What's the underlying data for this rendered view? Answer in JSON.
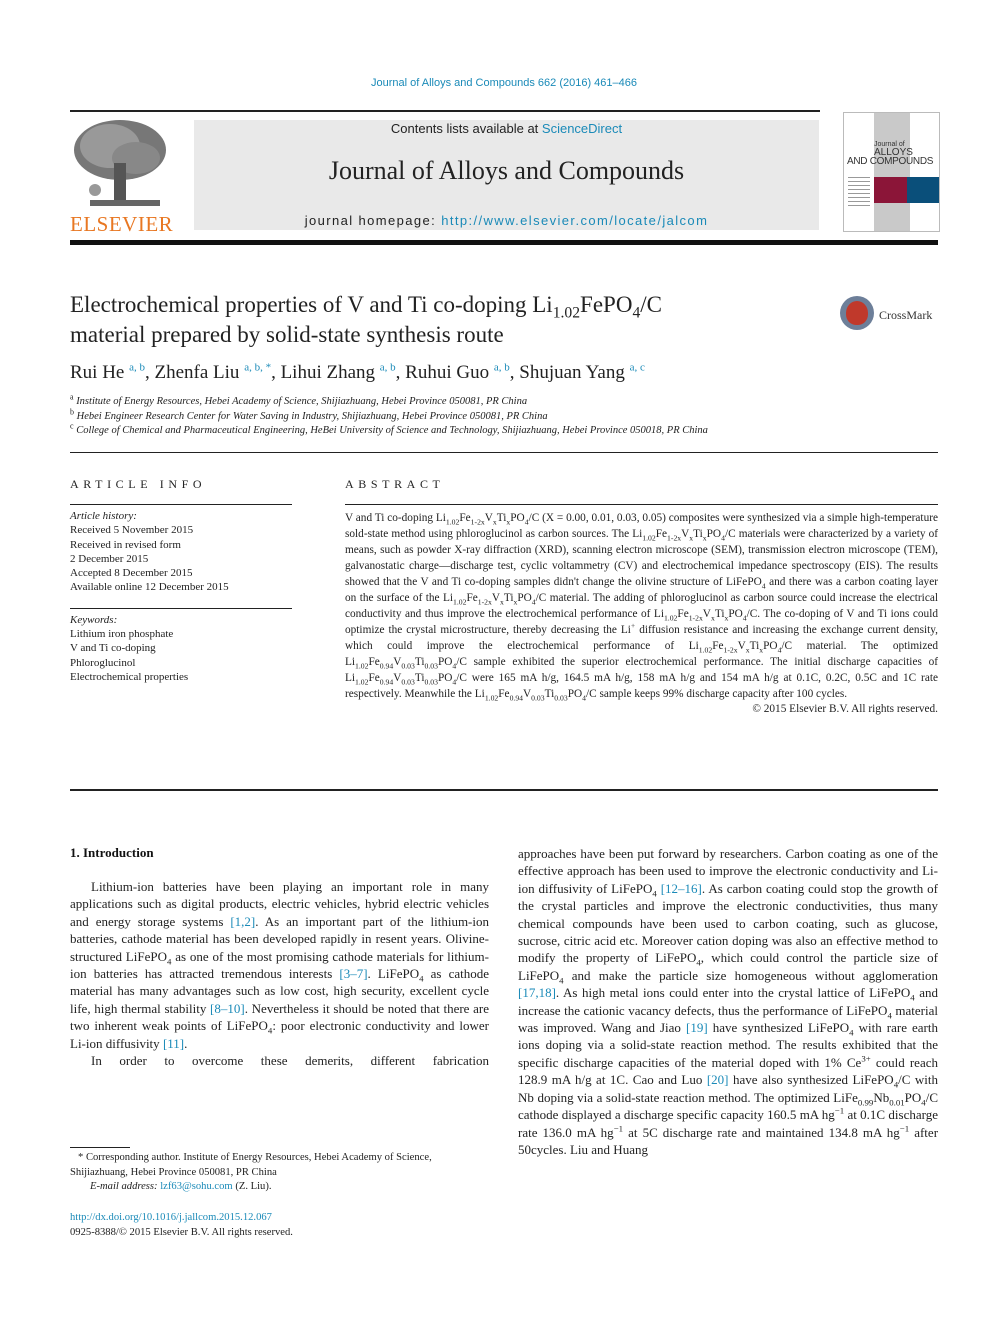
{
  "header": {
    "citation": "Journal of Alloys and Compounds 662 (2016) 461–466",
    "publisher_logo_text": "ELSEVIER",
    "contents_prefix": "Contents lists available at ",
    "contents_link": "ScienceDirect",
    "journal_title": "Journal of Alloys and Compounds",
    "homepage_prefix": "journal homepage: ",
    "homepage_link": "http://www.elsevier.com/locate/jalcom",
    "cover": {
      "line1": "Journal of",
      "line2": "ALLOYS",
      "line3": "AND COMPOUNDS",
      "colors": {
        "red": "#8b1538",
        "blue": "#0a4f7a"
      }
    }
  },
  "article": {
    "title_part1": "Electrochemical properties of V and Ti co-doping Li",
    "title_sub1": "1.02",
    "title_part2": "FePO",
    "title_sub2": "4",
    "title_part3": "/C",
    "title_line2": "material prepared by solid-state synthesis route",
    "crossmark_label": "CrossMark",
    "authors": [
      {
        "name": "Rui He",
        "affil": "a, b"
      },
      {
        "name": "Zhenfa Liu",
        "affil": "a, b, *"
      },
      {
        "name": "Lihui Zhang",
        "affil": "a, b"
      },
      {
        "name": "Ruhui Guo",
        "affil": "a, b"
      },
      {
        "name": "Shujuan Yang",
        "affil": "a, c"
      }
    ],
    "affiliations": [
      {
        "key": "a",
        "text": "Institute of Energy Resources, Hebei Academy of Science, Shijiazhuang, Hebei Province 050081, PR China"
      },
      {
        "key": "b",
        "text": "Hebei Engineer Research Center for Water Saving in Industry, Shijiazhuang, Hebei Province 050081, PR China"
      },
      {
        "key": "c",
        "text": "College of Chemical and Pharmaceutical Engineering, HeBei University of Science and Technology, Shijiazhuang, Hebei Province 050018, PR China"
      }
    ]
  },
  "article_info": {
    "heading": "ARTICLE INFO",
    "history_label": "Article history:",
    "history": [
      "Received 5 November 2015",
      "Received in revised form",
      "2 December 2015",
      "Accepted 8 December 2015",
      "Available online 12 December 2015"
    ],
    "keywords_label": "Keywords:",
    "keywords": [
      "Lithium iron phosphate",
      "V and Ti co-doping",
      "Phloroglucinol",
      "Electrochemical properties"
    ]
  },
  "abstract": {
    "heading": "ABSTRACT",
    "s1": "V and Ti co-doping ",
    "s2": " (X = 0.00, 0.01, 0.03, 0.05) composites were synthesized via a simple high-temperature sold-state method using phloroglucinol as carbon sources. The ",
    "s3": " materials were characterized by a variety of means, such as powder X-ray diffraction (XRD), scanning electron microscope (SEM), transmission electron microscope (TEM), galvanostatic charge—discharge test, cyclic voltammetry (CV) and electrochemical impedance spectroscopy (EIS). The results showed that the V and Ti co-doping samples didn't change the olivine structure of LiFePO",
    "s4": " and there was a carbon coating layer on the surface of the ",
    "s5": " material. The adding of phloroglucinol as carbon source could increase the electrical conductivity and thus improve the electrochemical performance of ",
    "s6": ". The co-doping of V and Ti ions could optimize the crystal microstructure, thereby decreasing the Li",
    "s7": " diffusion resistance and increasing the exchange current density, which could improve the electrochemical performance of ",
    "s8": " material. The optimized ",
    "s9": " sample exhibited the superior electrochemical performance. The initial discharge capacities of ",
    "s10": " were 165 mA h/g, 164.5 mA h/g, 158 mA h/g and 154 mA h/g at 0.1C, 0.2C, 0.5C and 1C rate respectively. Meanwhile the ",
    "s11": " sample keeps 99% discharge capacity after 100 cycles.",
    "copyright": "© 2015 Elsevier B.V. All rights reserved."
  },
  "introduction": {
    "heading": "1.  Introduction",
    "p1a": "Lithium-ion batteries have been playing an important role in many applications such as digital products, electric vehicles, hybrid electric vehicles and energy storage systems ",
    "ref1": "[1,2]",
    "p1b": ". As an important part of the lithium-ion batteries, cathode material has been developed rapidly in resent years. Olivine-structured LiFePO",
    "p1c": " as one of the most promising cathode materials for lithium-ion batteries has attracted tremendous interests ",
    "ref2": "[3–7]",
    "p1d": ". LiFePO",
    "p1e": " as cathode material has many advantages such as low cost, high security, excellent cycle life, high thermal stability ",
    "ref3": "[8–10]",
    "p1f": ". Nevertheless it should be noted that there are two inherent weak points of LiFePO",
    "p1g": ": poor electronic conductivity and lower Li-ion diffusivity ",
    "ref4": "[11]",
    "p1h": ".",
    "p2a": "In order to overcome these demerits, different fabrication approaches have been put forward by researchers. Carbon coating as one of the effective approach has been used to improve the electronic conductivity and Li-ion diffusivity of LiFePO",
    "ref5": "[12–16]",
    "p2b": ". As carbon coating could stop the growth of the crystal particles and improve the electronic conductivities, thus many chemical compounds have been used to carbon coating, such as glucose, sucrose, citric acid etc. Moreover cation doping was also an effective method to modify the property of LiFePO",
    "p2c": ", which could control the particle size of LiFePO",
    "p2d": " and make the particle size homogeneous without agglomeration ",
    "ref6": "[17,18]",
    "p2e": ". As high metal ions could enter into the crystal lattice of LiFePO",
    "p2f": " and increase the cationic vacancy defects, thus the performance of LiFePO",
    "p2g": " material was improved. Wang and Jiao ",
    "ref7": "[19]",
    "p2h": " have synthesized LiFePO",
    "p2i": " with rare earth ions doping via a solid-state reaction method. The results exhibited that the specific discharge capacities of the material doped with 1% Ce",
    "p2j": " could reach 128.9 mA h/g at 1C. Cao and Luo ",
    "ref8": "[20]",
    "p2k": " have also synthesized LiFePO",
    "p2l": "/C with Nb doping via a solid-state reaction method. The optimized LiFe",
    "p2m": "Nb",
    "p2n": "PO",
    "p2o": "/C cathode displayed a discharge specific capacity 160.5 mA hg",
    "p2p": " at 0.1C discharge rate 136.0 mA hg",
    "p2q": " at 5C discharge rate and maintained 134.8 mA hg",
    "p2r": " after 50cycles. Liu and Huang"
  },
  "footnotes": {
    "corresponding": "* Corresponding author. Institute of Energy Resources, Hebei Academy of Science, Shijiazhuang, Hebei Province 050081, PR China",
    "email_label": "E-mail address: ",
    "email": "lzf63@sohu.com",
    "email_suffix": " (Z. Liu).",
    "doi": "http://dx.doi.org/10.1016/j.jallcom.2015.12.067",
    "issn": "0925-8388/© 2015 Elsevier B.V. All rights reserved."
  },
  "colors": {
    "link": "#1a8ab8",
    "elsevier_orange": "#e87722",
    "banner_bg": "#e9e9e9"
  }
}
